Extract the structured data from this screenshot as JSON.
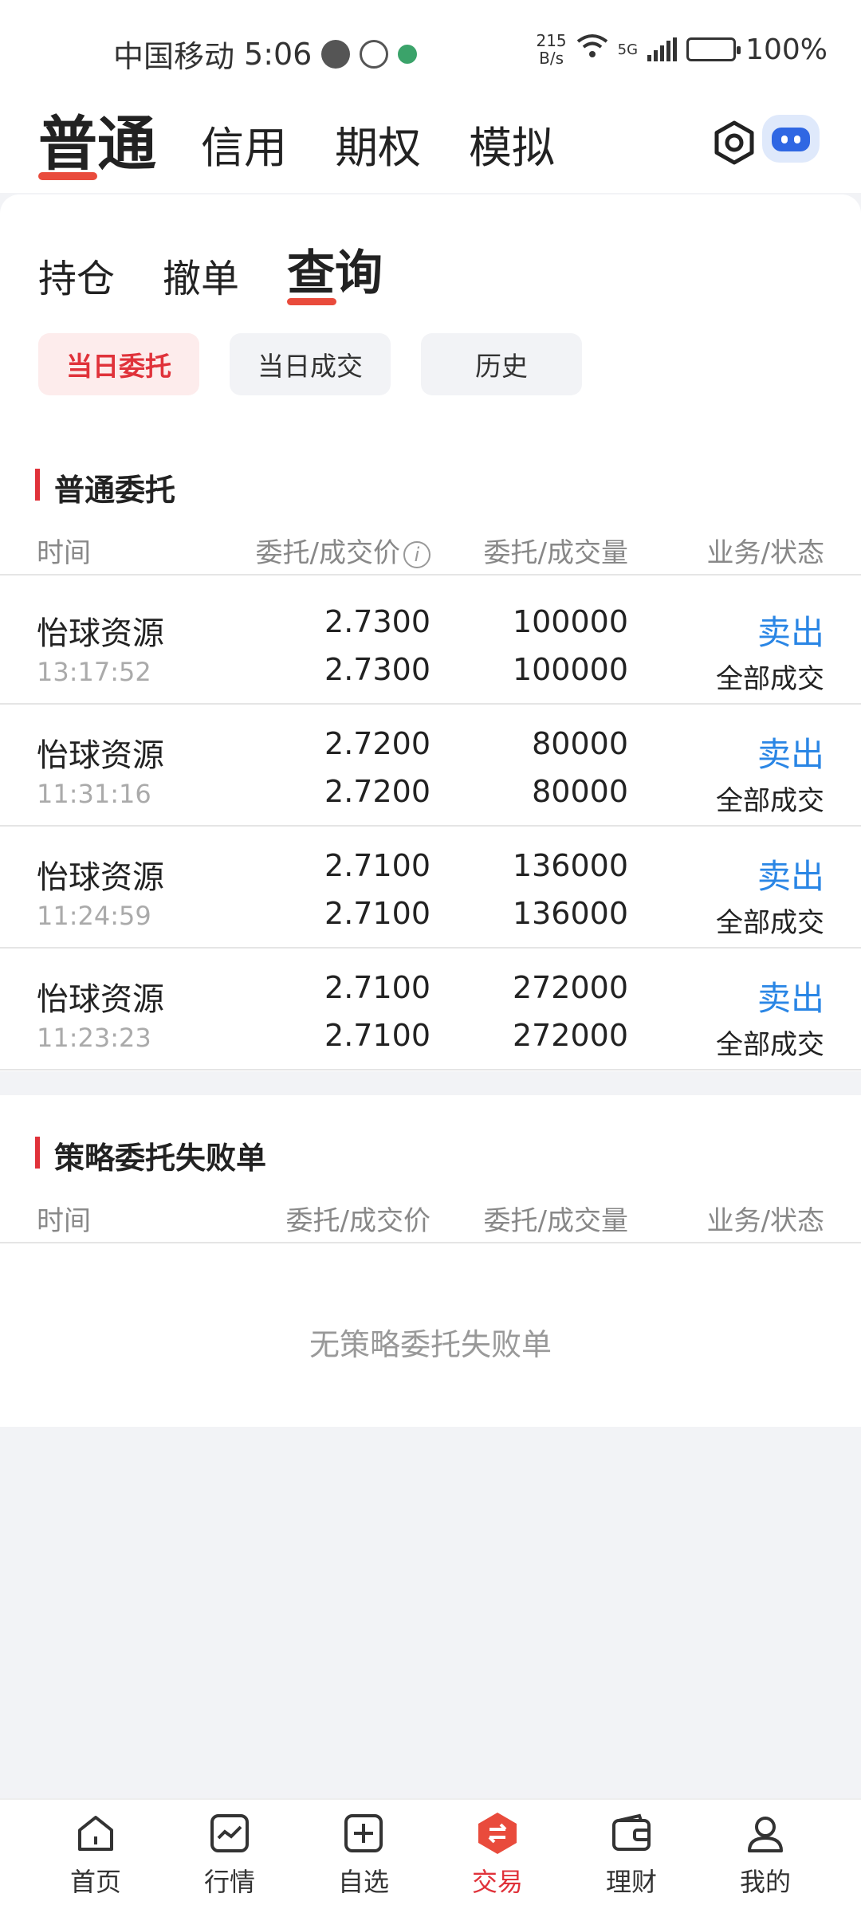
{
  "status_bar": {
    "carrier": "中国移动",
    "time": "5:06",
    "speed_value": "215",
    "speed_unit": "B/s",
    "network": "5G",
    "battery": "100%"
  },
  "top_nav": {
    "tabs": [
      {
        "label": "普通",
        "active": true
      },
      {
        "label": "信用",
        "active": false
      },
      {
        "label": "期权",
        "active": false
      },
      {
        "label": "模拟",
        "active": false
      }
    ]
  },
  "sub_tabs": [
    {
      "label": "持仓",
      "active": false
    },
    {
      "label": "撤单",
      "active": false
    },
    {
      "label": "查询",
      "active": true
    }
  ],
  "filters": [
    {
      "label": "当日委托",
      "active": true
    },
    {
      "label": "当日成交",
      "active": false
    },
    {
      "label": "历史",
      "active": false
    }
  ],
  "normal_orders": {
    "title": "普通委托",
    "columns": [
      "时间",
      "委托/成交价",
      "委托/成交量",
      "业务/状态"
    ],
    "rows": [
      {
        "name": "怡球资源",
        "time": "13:17:52",
        "order_price": "2.7300",
        "deal_price": "2.7300",
        "order_qty": "100000",
        "deal_qty": "100000",
        "action": "卖出",
        "status": "全部成交"
      },
      {
        "name": "怡球资源",
        "time": "11:31:16",
        "order_price": "2.7200",
        "deal_price": "2.7200",
        "order_qty": "80000",
        "deal_qty": "80000",
        "action": "卖出",
        "status": "全部成交"
      },
      {
        "name": "怡球资源",
        "time": "11:24:59",
        "order_price": "2.7100",
        "deal_price": "2.7100",
        "order_qty": "136000",
        "deal_qty": "136000",
        "action": "卖出",
        "status": "全部成交"
      },
      {
        "name": "怡球资源",
        "time": "11:23:23",
        "order_price": "2.7100",
        "deal_price": "2.7100",
        "order_qty": "272000",
        "deal_qty": "272000",
        "action": "卖出",
        "status": "全部成交"
      }
    ]
  },
  "strategy_orders": {
    "title": "策略委托失败单",
    "columns": [
      "时间",
      "委托/成交价",
      "委托/成交量",
      "业务/状态"
    ],
    "empty_message": "无策略委托失败单"
  },
  "bottom_nav": [
    {
      "label": "首页",
      "icon": "home-icon",
      "active": false
    },
    {
      "label": "行情",
      "icon": "chart-icon",
      "active": false
    },
    {
      "label": "自选",
      "icon": "add-square-icon",
      "active": false
    },
    {
      "label": "交易",
      "icon": "trade-icon",
      "active": true
    },
    {
      "label": "理财",
      "icon": "wallet-icon",
      "active": false
    },
    {
      "label": "我的",
      "icon": "user-icon",
      "active": false
    }
  ],
  "colors": {
    "accent_red": "#e0323a",
    "action_blue": "#2a86e5"
  }
}
